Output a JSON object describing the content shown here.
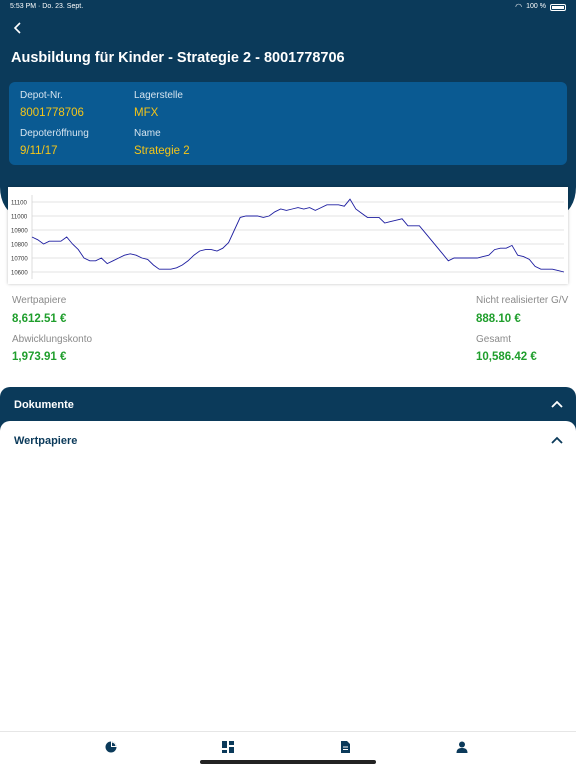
{
  "status_bar": {
    "time_date": "5:53 PM · Do. 23. Sept.",
    "battery": "100 %"
  },
  "header": {
    "title": "Ausbildung für Kinder - Strategie 2 - 8001778706"
  },
  "info": {
    "depot_label": "Depot-Nr.",
    "depot_value": "8001778706",
    "lagerstelle_label": "Lagerstelle",
    "lagerstelle_value": "MFX",
    "eroeffnung_label": "Depoteröffnung",
    "eroeffnung_value": "9/11/17",
    "name_label": "Name",
    "name_value": "Strategie 2"
  },
  "chart_data": {
    "type": "line",
    "yticks": [
      "11100",
      "11000",
      "10900",
      "10800",
      "10700",
      "10600"
    ],
    "ylim": [
      10550,
      11150
    ],
    "grid": true,
    "color": "#1e1ea0",
    "values": [
      10850,
      10830,
      10800,
      10820,
      10820,
      10820,
      10850,
      10800,
      10760,
      10700,
      10680,
      10680,
      10700,
      10660,
      10680,
      10700,
      10720,
      10730,
      10720,
      10700,
      10690,
      10650,
      10620,
      10620,
      10620,
      10630,
      10650,
      10680,
      10720,
      10750,
      10760,
      10760,
      10750,
      10770,
      10810,
      10900,
      10990,
      11000,
      11000,
      11000,
      10990,
      11000,
      11030,
      11050,
      11040,
      11050,
      11060,
      11050,
      11060,
      11040,
      11060,
      11080,
      11080,
      11080,
      11070,
      11120,
      11050,
      11020,
      10990,
      10990,
      10990,
      10950,
      10960,
      10970,
      10980,
      10930,
      10930,
      10930,
      10880,
      10830,
      10780,
      10730,
      10680,
      10700,
      10700,
      10700,
      10700,
      10700,
      10710,
      10720,
      10760,
      10770,
      10770,
      10790,
      10720,
      10710,
      10690,
      10640,
      10620,
      10620,
      10620,
      10610,
      10600
    ]
  },
  "summary": {
    "wertpapiere_label": "Wertpapiere",
    "wertpapiere_value": "8,612.51 €",
    "abwicklungskonto_label": "Abwicklungskonto",
    "abwicklungskonto_value": "1,973.91 €",
    "gv_label": "Nicht realisierter G/V",
    "gv_value": "888.10 €",
    "gesamt_label": "Gesamt",
    "gesamt_value": "10,586.42 €"
  },
  "sections": {
    "dokumente": "Dokumente",
    "wertpapiere": "Wertpapiere"
  },
  "tabs": [
    {
      "icon": "pie-chart-icon"
    },
    {
      "icon": "dashboard-icon"
    },
    {
      "icon": "document-icon"
    },
    {
      "icon": "person-icon"
    }
  ]
}
